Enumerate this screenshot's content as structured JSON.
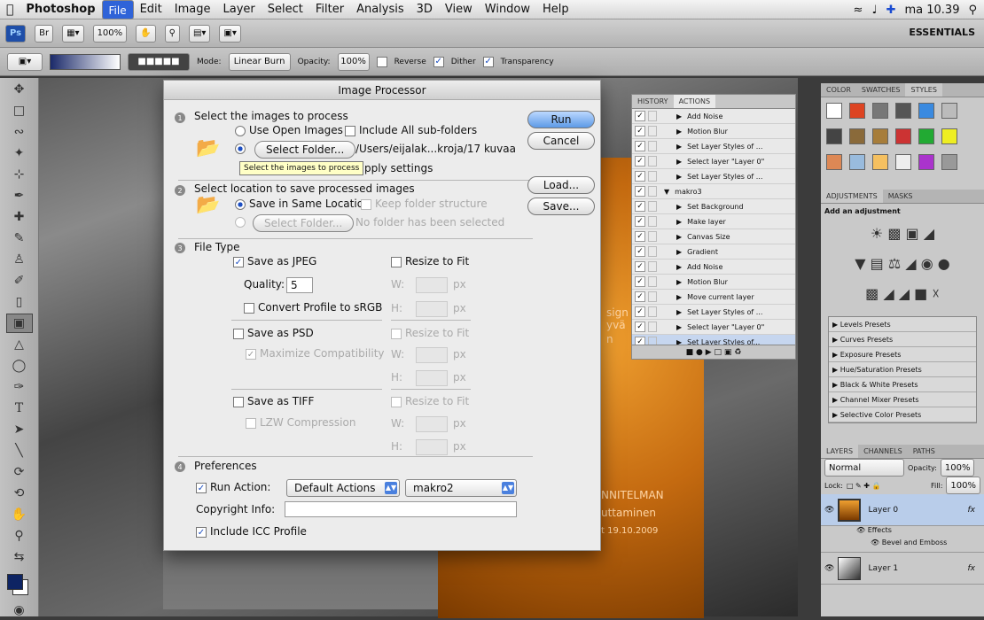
{
  "menubar": {
    "app": "Photoshop",
    "items": [
      "File",
      "Edit",
      "Image",
      "Layer",
      "Select",
      "Filter",
      "Analysis",
      "3D",
      "View",
      "Window",
      "Help"
    ],
    "clock": "ma 10.39"
  },
  "appbar": {
    "ps": "Ps",
    "br": "Br",
    "zoom": "100%",
    "workspace": "ESSENTIALS"
  },
  "options": {
    "mode_label": "Mode:",
    "mode": "Linear Burn",
    "opacity_label": "Opacity:",
    "opacity": "100%",
    "reverse": "Reverse",
    "dither": "Dither",
    "transparency": "Transparency"
  },
  "dialog": {
    "title": "Image Processor",
    "sec1": "Select the images to process",
    "use_open": "Use Open Images",
    "include_sub": "Include All sub-folders",
    "select_folder": "Select Folder...",
    "folder_path": "/Users/eijalak...kroja/17 kuvaa",
    "tooltip": "Select the images to process",
    "apply_settings": "pply settings",
    "sec2": "Select location to save processed images",
    "save_same": "Save in Same Location",
    "keep_structure": "Keep folder structure",
    "select_folder2": "Select Folder...",
    "no_folder": "No folder has been selected",
    "sec3": "File Type",
    "save_jpeg": "Save as JPEG",
    "resize": "Resize to Fit",
    "quality_label": "Quality:",
    "quality": "5",
    "w": "W:",
    "h": "H:",
    "px": "px",
    "convert": "Convert Profile to sRGB",
    "save_psd": "Save as PSD",
    "max_compat": "Maximize Compatibility",
    "save_tiff": "Save as TIFF",
    "lzw": "LZW Compression",
    "sec4": "Preferences",
    "run_action": "Run Action:",
    "action_set": "Default Actions",
    "action": "makro2",
    "copyright": "Copyright Info:",
    "icc": "Include ICC Profile",
    "run": "Run",
    "cancel": "Cancel",
    "load": "Load...",
    "save": "Save...",
    "steps": [
      "1",
      "2",
      "3",
      "4"
    ]
  },
  "doc_text": {
    "a": "sign",
    "b": "yvä",
    "c": "n",
    "d": "NNITELMAN",
    "e": "uttaminen",
    "f": "t 19.10.2009"
  },
  "actions": {
    "tabs": [
      "HISTORY",
      "ACTIONS"
    ],
    "rows": [
      "Add Noise",
      "Motion Blur",
      "Set Layer Styles of ...",
      "Select layer \"Layer 0\"",
      "Set Layer Styles of ...",
      "makro3",
      "Set Background",
      "Make layer",
      "Canvas Size",
      "Gradient",
      "Add Noise",
      "Motion Blur",
      "Move current layer",
      "Set Layer Styles of ...",
      "Select layer \"Layer 0\"",
      "Set Layer Styles of..."
    ]
  },
  "right": {
    "tabs1": [
      "COLOR",
      "SWATCHES",
      "STYLES"
    ],
    "tabs2": [
      "ADJUSTMENTS",
      "MASKS"
    ],
    "add_adj": "Add an adjustment",
    "presets": [
      "Levels Presets",
      "Curves Presets",
      "Exposure Presets",
      "Hue/Saturation Presets",
      "Black & White Presets",
      "Channel Mixer Presets",
      "Selective Color Presets"
    ],
    "tabs3": [
      "LAYERS",
      "CHANNELS",
      "PATHS"
    ],
    "blend": "Normal",
    "opacity_label": "Opacity:",
    "opacity": "100%",
    "lock": "Lock:",
    "fill_label": "Fill:",
    "fill": "100%",
    "layer0": "Layer 0",
    "effects": "Effects",
    "bevel": "Bevel and Emboss",
    "layer1": "Layer 1",
    "fx": "fx"
  }
}
